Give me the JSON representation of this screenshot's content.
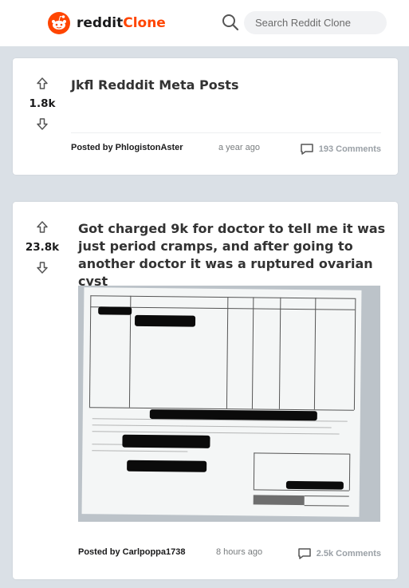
{
  "header": {
    "logo_text_prefix": "reddit",
    "logo_text_accent": "Clone",
    "search_placeholder": "Search Reddit Clone"
  },
  "posts": [
    {
      "score": "1.8k",
      "title": "Jkfl Redddit Meta Posts",
      "author": "Posted by PhlogistonAster",
      "time": "a year ago",
      "comments": "193 Comments"
    },
    {
      "score": "23.8k",
      "title": "Got charged 9k for doctor to tell me it was just period cramps, and after going to another doctor it was a ruptured ovarian cyst",
      "author": "Posted by Carlpoppa1738",
      "time": "8 hours ago",
      "comments": "2.5k Comments"
    }
  ],
  "colors": {
    "brand": "#ff4500",
    "background": "#dae0e6"
  },
  "icons": [
    "reddit-logo-icon",
    "search-icon",
    "upvote-icon",
    "downvote-icon",
    "comment-icon"
  ]
}
